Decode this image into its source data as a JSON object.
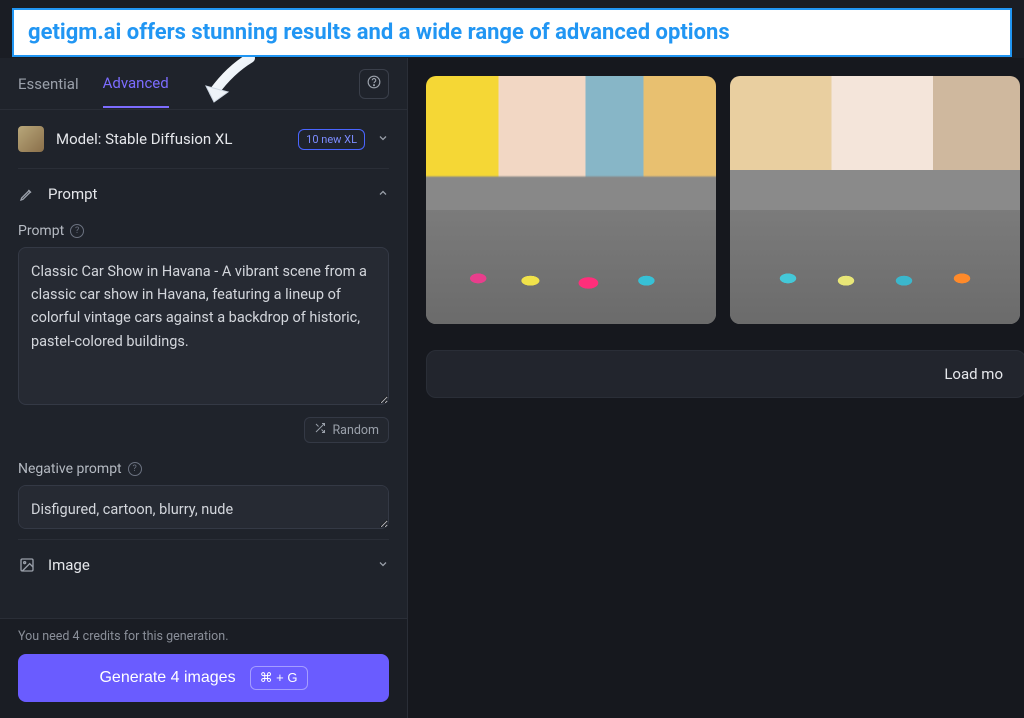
{
  "banner": {
    "text": "getigm.ai offers stunning results and a wide range of advanced options"
  },
  "tabs": {
    "essential": "Essential",
    "advanced": "Advanced",
    "active": "advanced"
  },
  "model": {
    "label": "Model: Stable Diffusion XL",
    "badge": "10 new XL"
  },
  "prompt_section": {
    "title": "Prompt",
    "prompt_label": "Prompt",
    "prompt_value": "Classic Car Show in Havana - A vibrant scene from a classic car show in Havana, featuring a lineup of colorful vintage cars against a backdrop of historic, pastel-colored buildings.",
    "random_label": "Random",
    "negative_label": "Negative prompt",
    "negative_value": "Disfigured, cartoon, blurry, nude"
  },
  "image_section": {
    "title": "Image"
  },
  "footer": {
    "credits": "You need 4 credits for this generation.",
    "generate_label": "Generate 4 images",
    "shortcut": "⌘ + G"
  },
  "main": {
    "load_more": "Load mo"
  }
}
